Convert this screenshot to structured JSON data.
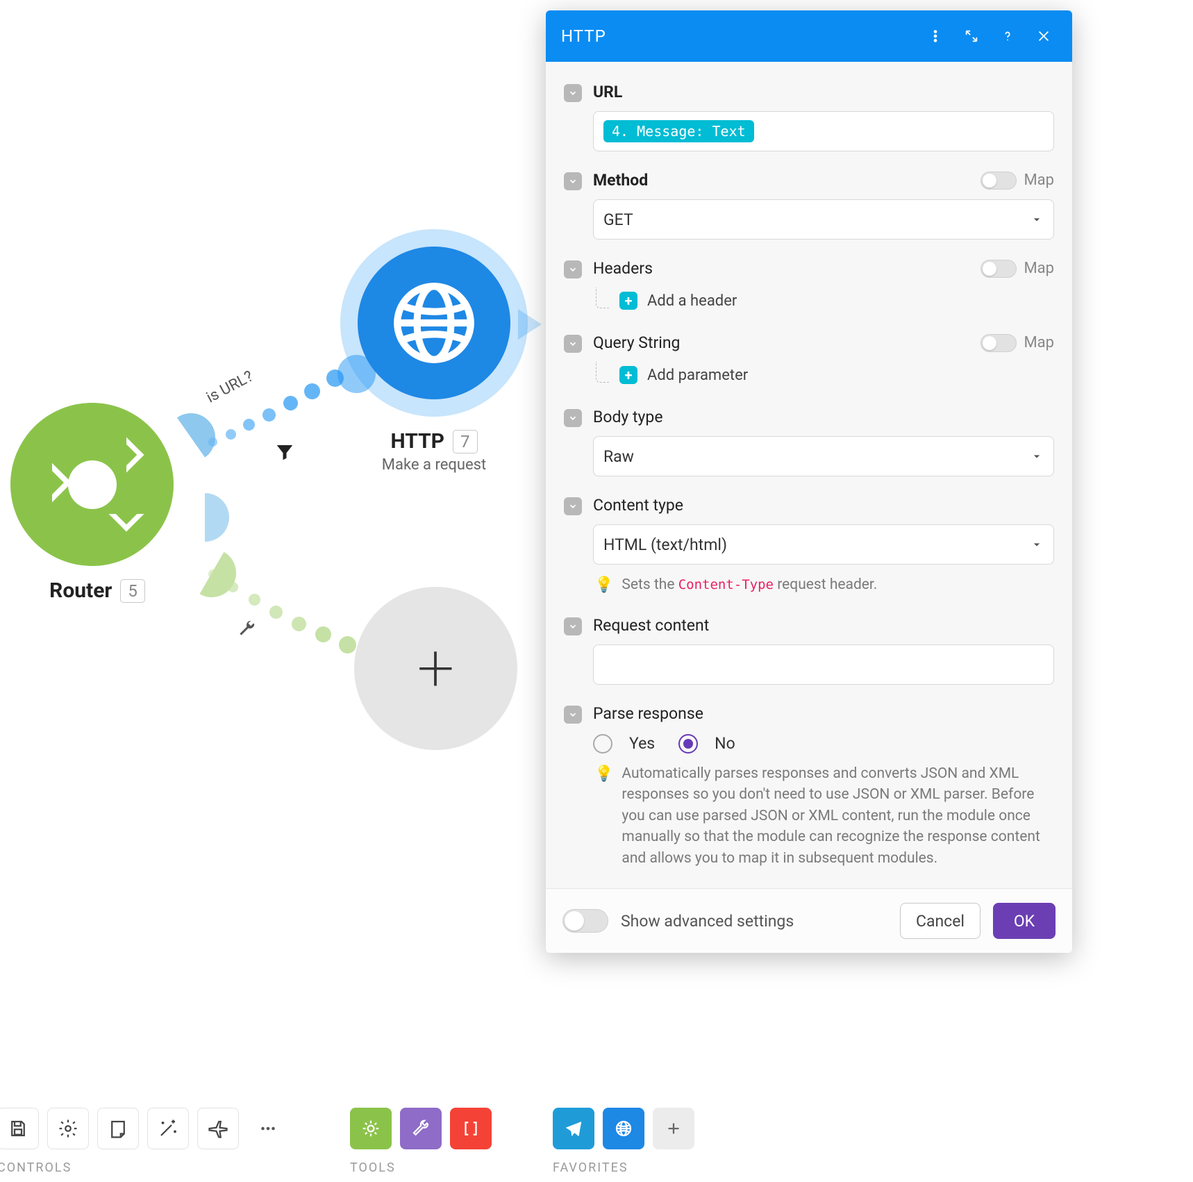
{
  "canvas": {
    "router": {
      "title": "Router",
      "badge": "5"
    },
    "http_node": {
      "title": "HTTP",
      "badge": "7",
      "subtitle": "Make a request"
    },
    "edge_label": "is URL?"
  },
  "panel": {
    "title": "HTTP",
    "url": {
      "label": "URL",
      "pill": "4. Message: Text"
    },
    "method": {
      "label": "Method",
      "map": "Map",
      "value": "GET"
    },
    "headers": {
      "label": "Headers",
      "map": "Map",
      "add": "Add a header"
    },
    "query": {
      "label": "Query String",
      "map": "Map",
      "add": "Add parameter"
    },
    "body_type": {
      "label": "Body type",
      "value": "Raw"
    },
    "content_type": {
      "label": "Content type",
      "value": "HTML (text/html)",
      "hint_prefix": "Sets the ",
      "hint_code": "Content-Type",
      "hint_suffix": " request header."
    },
    "request_content": {
      "label": "Request content",
      "value": ""
    },
    "parse": {
      "label": "Parse response",
      "yes": "Yes",
      "no": "No",
      "selected": "No",
      "hint": "Automatically parses responses and converts JSON and XML responses so you don't need to use JSON or XML parser. Before you can use parsed JSON or XML content, run the module once manually so that the module can recognize the response content and allows you to map it in subsequent modules."
    },
    "footer": {
      "advanced": "Show advanced settings",
      "cancel": "Cancel",
      "ok": "OK"
    }
  },
  "toolbar": {
    "controls_label": "CONTROLS",
    "tools_label": "TOOLS",
    "favorites_label": "FAVORITES"
  }
}
